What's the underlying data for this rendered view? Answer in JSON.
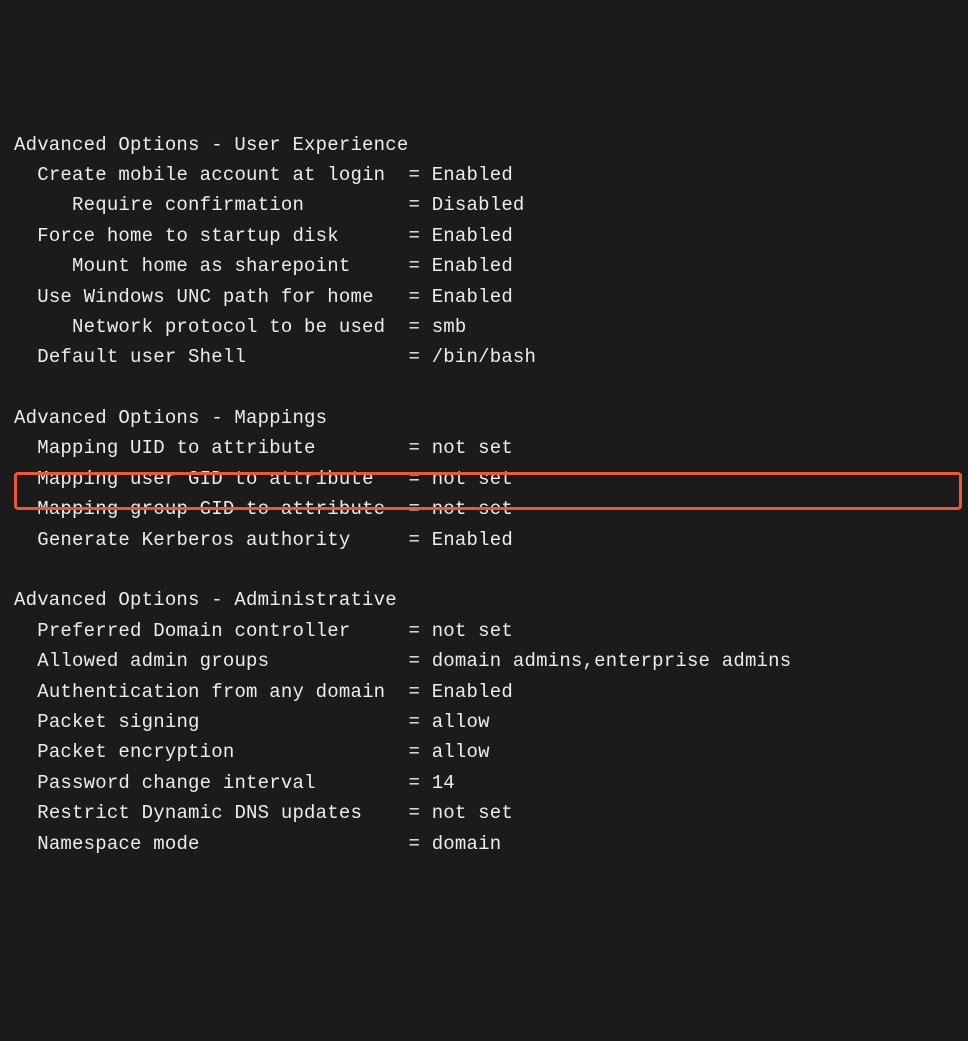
{
  "sections": {
    "ux": {
      "header": "Advanced Options - User Experience",
      "rows": [
        {
          "indent": 1,
          "label": "Create mobile account at login",
          "eq": "=",
          "value": "Enabled"
        },
        {
          "indent": 2,
          "label": "Require confirmation",
          "eq": "=",
          "value": "Disabled"
        },
        {
          "indent": 1,
          "label": "Force home to startup disk",
          "eq": "=",
          "value": "Enabled"
        },
        {
          "indent": 2,
          "label": "Mount home as sharepoint",
          "eq": "=",
          "value": "Enabled"
        },
        {
          "indent": 1,
          "label": "Use Windows UNC path for home",
          "eq": "=",
          "value": "Enabled"
        },
        {
          "indent": 2,
          "label": "Network protocol to be used",
          "eq": "=",
          "value": "smb"
        },
        {
          "indent": 1,
          "label": "Default user Shell",
          "eq": "=",
          "value": "/bin/bash"
        }
      ]
    },
    "mappings": {
      "header": "Advanced Options - Mappings",
      "rows": [
        {
          "indent": 1,
          "label": "Mapping UID to attribute",
          "eq": "=",
          "value": "not set"
        },
        {
          "indent": 1,
          "label": "Mapping user GID to attribute",
          "eq": "=",
          "value": "not set"
        },
        {
          "indent": 1,
          "label": "Mapping group GID to attribute",
          "eq": "=",
          "value": "not set"
        },
        {
          "indent": 1,
          "label": "Generate Kerberos authority",
          "eq": "=",
          "value": "Enabled"
        }
      ]
    },
    "admin": {
      "header": "Advanced Options - Administrative",
      "rows": [
        {
          "indent": 1,
          "label": "Preferred Domain controller",
          "eq": "=",
          "value": "not set"
        },
        {
          "indent": 1,
          "label": "Allowed admin groups",
          "eq": "=",
          "value": "domain admins,enterprise admins"
        },
        {
          "indent": 1,
          "label": "Authentication from any domain",
          "eq": "=",
          "value": "Enabled"
        },
        {
          "indent": 1,
          "label": "Packet signing",
          "eq": "=",
          "value": "allow"
        },
        {
          "indent": 1,
          "label": "Packet encryption",
          "eq": "=",
          "value": "allow"
        },
        {
          "indent": 1,
          "label": "Password change interval",
          "eq": "=",
          "value": "14"
        },
        {
          "indent": 1,
          "label": "Restrict Dynamic DNS updates",
          "eq": "=",
          "value": "not set"
        },
        {
          "indent": 1,
          "label": "Namespace mode",
          "eq": "=",
          "value": "domain"
        }
      ]
    },
    "highlighted_row_index": 1,
    "column_positions": {
      "label_width_ch": 31,
      "eq_col_ch": 34,
      "value_col_ch": 36
    }
  }
}
